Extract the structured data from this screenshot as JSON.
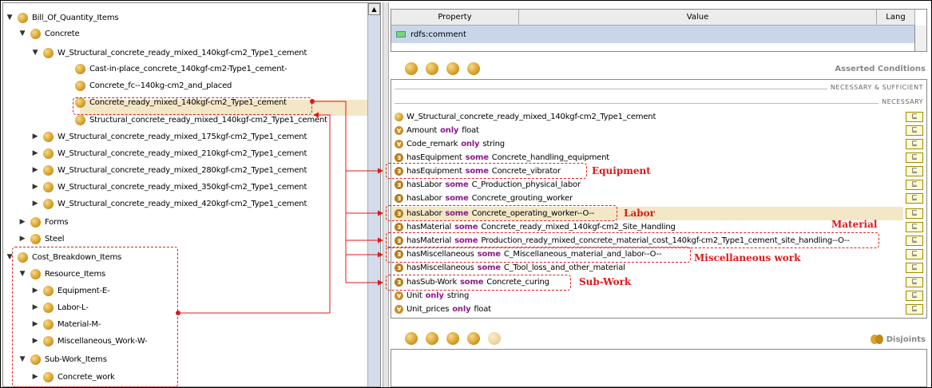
{
  "tree": {
    "items": [
      {
        "label": "Bill_Of_Quantity_Items",
        "tw": "▼"
      },
      {
        "label": "Concrete",
        "tw": "▼"
      },
      {
        "label": "W_Structural_concrete_ready_mixed_140kgf-cm2_Type1_cement",
        "tw": "▼"
      },
      {
        "label": "Cast-in-place_concrete_140kgf-cm2-Type1_cement-",
        "tw": ""
      },
      {
        "label": "Concrete_fc--140kg-cm2_and_placed",
        "tw": ""
      },
      {
        "label": "Concrete_ready_mixed_140kgf-cm2_Type1_cement",
        "tw": ""
      },
      {
        "label": "Structural_concrete_ready_mixed_140kgf-cm2_Type1_cement",
        "tw": ""
      },
      {
        "label": "W_Structural_concrete_ready_mixed_175kgf-cm2_Type1_cement",
        "tw": "▶"
      },
      {
        "label": "W_Structural_concrete_ready_mixed_210kgf-cm2_Type1_cement",
        "tw": "▶"
      },
      {
        "label": "W_Structural_concrete_ready_mixed_280kgf-cm2_Type1_cement",
        "tw": "▶"
      },
      {
        "label": "W_Structural_concrete_ready_mixed_350kgf-cm2_Type1_cement",
        "tw": "▶"
      },
      {
        "label": "W_Structural_concrete_ready_mixed_420kgf-cm2_Type1_cement",
        "tw": "▶"
      },
      {
        "label": "Forms",
        "tw": "▶"
      },
      {
        "label": "Steel",
        "tw": "▶"
      },
      {
        "label": "Cost_Breakdown_Items",
        "tw": "▼"
      },
      {
        "label": "Resource_Items",
        "tw": "▼"
      },
      {
        "label": "Equipment-E-",
        "tw": "▶"
      },
      {
        "label": "Labor-L-",
        "tw": "▶"
      },
      {
        "label": "Material-M-",
        "tw": "▶"
      },
      {
        "label": "Miscellaneous_Work-W-",
        "tw": "▶"
      },
      {
        "label": "Sub-Work_Items",
        "tw": "▼"
      },
      {
        "label": "Concrete_work",
        "tw": "▶"
      }
    ]
  },
  "property_table": {
    "col_property": "Property",
    "col_value": "Value",
    "col_lang": "Lang",
    "row_property": "rdfs:comment"
  },
  "conditions": {
    "title": "Asserted Conditions",
    "sep_necessary_sufficient": "NECESSARY & SUFFICIENT",
    "sep_necessary": "NECESSARY",
    "eq_symbol": "⊑",
    "rows": [
      {
        "icon": "class",
        "subject": "W_Structural_concrete_ready_mixed_140kgf-cm2_Type1_cement",
        "kw": "",
        "object": ""
      },
      {
        "icon": "only",
        "subject": "Amount",
        "kw": "only",
        "object": "float"
      },
      {
        "icon": "only",
        "subject": "Code_remark",
        "kw": "only",
        "object": "string"
      },
      {
        "icon": "some",
        "subject": "hasEquipment",
        "kw": "some",
        "object": "Concrete_handling_equipment"
      },
      {
        "icon": "some",
        "subject": "hasEquipment",
        "kw": "some",
        "object": "Concrete_vibrator"
      },
      {
        "icon": "some",
        "subject": "hasLabor",
        "kw": "some",
        "object": "C_Production_physical_labor"
      },
      {
        "icon": "some",
        "subject": "hasLabor",
        "kw": "some",
        "object": "Concrete_grouting_worker"
      },
      {
        "icon": "some",
        "subject": "hasLabor",
        "kw": "some",
        "object": "Concrete_operating_worker--O--"
      },
      {
        "icon": "some",
        "subject": "hasMaterial",
        "kw": "some",
        "object": "Concrete_ready_mixed_140kgf-cm2_Site_Handling"
      },
      {
        "icon": "some",
        "subject": "hasMaterial",
        "kw": "some",
        "object": "Production_ready_mixed_concrete_material_cost_140kgf-cm2_Type1_cement_site_handling--O--"
      },
      {
        "icon": "some",
        "subject": "hasMiscellaneous",
        "kw": "some",
        "object": "C_Miscellaneous_material_and_labor--O--"
      },
      {
        "icon": "some",
        "subject": "hasMiscellaneous",
        "kw": "some",
        "object": "C_Tool_loss_and_other_material"
      },
      {
        "icon": "some",
        "subject": "hasSub-Work",
        "kw": "some",
        "object": "Concrete_curing"
      },
      {
        "icon": "only",
        "subject": "Unit",
        "kw": "only",
        "object": "string"
      },
      {
        "icon": "only",
        "subject": "Unit_prices",
        "kw": "only",
        "object": "float"
      }
    ]
  },
  "disjoints": {
    "title": "Disjoints"
  },
  "annotations": {
    "equipment": "Equipment",
    "labor": "Labor",
    "material": "Material",
    "misc": "Miscellaneous work",
    "subwork": "Sub-Work"
  },
  "colors": {
    "annotation_red": "#e01818",
    "selection": "#f3e7c8",
    "keyword_purple": "#8b1a8b",
    "header_blue": "#c9d6ea"
  }
}
